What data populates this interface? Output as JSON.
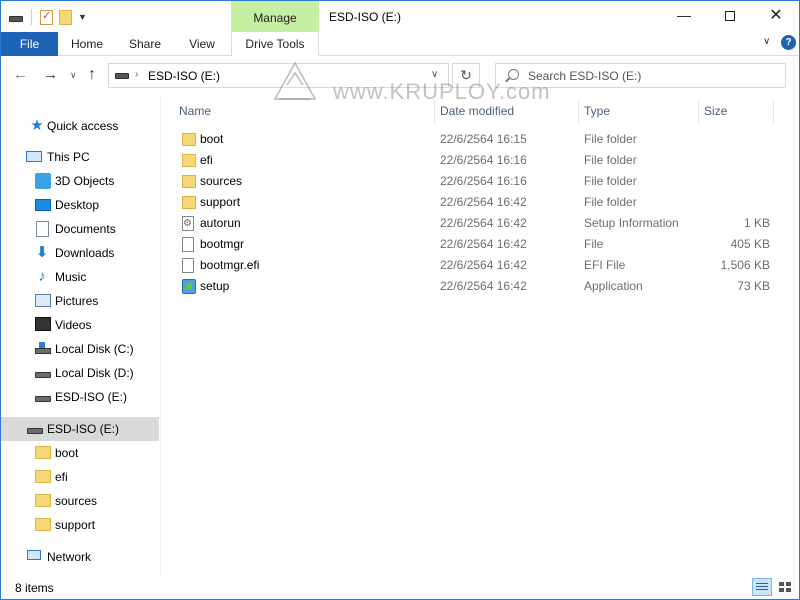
{
  "window": {
    "title": "ESD-ISO (E:)",
    "context_tab": "Manage",
    "minimize_glyph": "—",
    "close_glyph": "✕"
  },
  "ribbon": {
    "tabs": [
      {
        "label": "File"
      },
      {
        "label": "Home"
      },
      {
        "label": "Share"
      },
      {
        "label": "View"
      },
      {
        "label": "Drive Tools"
      }
    ],
    "expand_glyph": "∨",
    "help_glyph": "?"
  },
  "navigation": {
    "back_glyph": "←",
    "forward_glyph": "→",
    "recent_glyph": "∨",
    "up_glyph": "↑",
    "address_separator": "›",
    "address_text": "ESD-ISO (E:)",
    "address_dropdown": "∨",
    "refresh_glyph": "↻",
    "search_placeholder": "Search ESD-ISO (E:)"
  },
  "watermark": {
    "text": "www.KRUPLOY.com"
  },
  "sidebar": {
    "items": [
      {
        "label": "Quick access",
        "icon": "star-icon"
      },
      {
        "label": "This PC",
        "icon": "computer-icon"
      },
      {
        "label": "3D Objects",
        "icon": "3d-objects-icon"
      },
      {
        "label": "Desktop",
        "icon": "desktop-icon"
      },
      {
        "label": "Documents",
        "icon": "documents-icon"
      },
      {
        "label": "Downloads",
        "icon": "downloads-icon"
      },
      {
        "label": "Music",
        "icon": "music-icon"
      },
      {
        "label": "Pictures",
        "icon": "pictures-icon"
      },
      {
        "label": "Videos",
        "icon": "videos-icon"
      },
      {
        "label": "Local Disk (C:)",
        "icon": "windows-drive-icon"
      },
      {
        "label": "Local Disk (D:)",
        "icon": "drive-icon"
      },
      {
        "label": "ESD-ISO (E:)",
        "icon": "drive-icon"
      },
      {
        "label": "ESD-ISO (E:)",
        "icon": "drive-icon",
        "selected": true
      },
      {
        "label": "boot",
        "icon": "folder-icon"
      },
      {
        "label": "efi",
        "icon": "folder-icon"
      },
      {
        "label": "sources",
        "icon": "folder-icon"
      },
      {
        "label": "support",
        "icon": "folder-icon"
      },
      {
        "label": "Network",
        "icon": "network-icon"
      }
    ]
  },
  "filelist": {
    "columns": {
      "name": "Name",
      "date": "Date modified",
      "type": "Type",
      "size": "Size"
    },
    "rows": [
      {
        "name": "boot",
        "date": "22/6/2564 16:15",
        "type": "File folder",
        "size": "",
        "icon": "folder-icon"
      },
      {
        "name": "efi",
        "date": "22/6/2564 16:16",
        "type": "File folder",
        "size": "",
        "icon": "folder-icon"
      },
      {
        "name": "sources",
        "date": "22/6/2564 16:16",
        "type": "File folder",
        "size": "",
        "icon": "folder-icon"
      },
      {
        "name": "support",
        "date": "22/6/2564 16:42",
        "type": "File folder",
        "size": "",
        "icon": "folder-icon"
      },
      {
        "name": "autorun",
        "date": "22/6/2564 16:42",
        "type": "Setup Information",
        "size": "1 KB",
        "icon": "setup-info-file-icon"
      },
      {
        "name": "bootmgr",
        "date": "22/6/2564 16:42",
        "type": "File",
        "size": "405 KB",
        "icon": "file-icon"
      },
      {
        "name": "bootmgr.efi",
        "date": "22/6/2564 16:42",
        "type": "EFI File",
        "size": "1,506 KB",
        "icon": "file-icon"
      },
      {
        "name": "setup",
        "date": "22/6/2564 16:42",
        "type": "Application",
        "size": "73 KB",
        "icon": "application-icon"
      }
    ]
  },
  "status": {
    "item_count": "8 items"
  },
  "colors": {
    "accent": "#1e62b6",
    "context_tab_bg": "#c6efa3",
    "selection_bg": "#d9d9d9",
    "folder": "#f8d775"
  }
}
